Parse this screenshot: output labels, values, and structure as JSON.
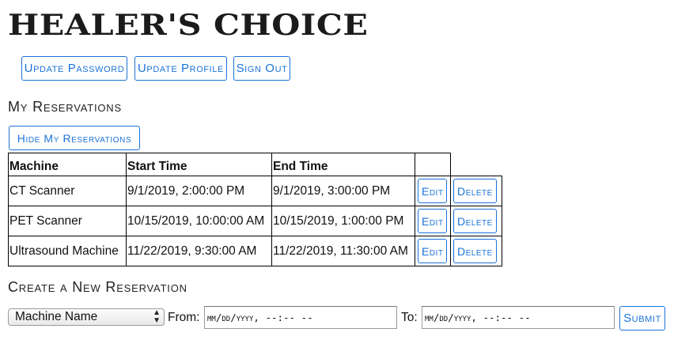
{
  "brand": {
    "title": "HEALER'S CHOICE"
  },
  "account_nav": {
    "update_password": "Update Password",
    "update_profile": "Update Profile",
    "sign_out": "Sign Out"
  },
  "reservations": {
    "heading": "My Reservations",
    "toggle_label": "Hide My Reservations",
    "columns": [
      "Machine",
      "Start Time",
      "End Time"
    ],
    "rows": [
      {
        "machine": "CT Scanner",
        "start": "9/1/2019, 2:00:00 PM",
        "end": "9/1/2019, 3:00:00 PM",
        "edit": "Edit",
        "delete": "Delete"
      },
      {
        "machine": "PET Scanner",
        "start": "10/15/2019, 10:00:00 AM",
        "end": "10/15/2019, 1:00:00 PM",
        "edit": "Edit",
        "delete": "Delete"
      },
      {
        "machine": "Ultrasound Machine",
        "start": "11/22/2019, 9:30:00 AM",
        "end": "11/22/2019, 11:30:00 AM",
        "edit": "Edit",
        "delete": "Delete"
      }
    ]
  },
  "create": {
    "heading": "Create a New Reservation",
    "machine_select": "Machine Name",
    "from_label": "From:",
    "from_value": "mm/dd/yyyy, --:-- --",
    "to_label": "To:",
    "to_value": "mm/dd/yyyy, --:-- --",
    "submit": "Submit"
  },
  "colors": {
    "accent": "#1a73d9",
    "border": "#000000"
  }
}
